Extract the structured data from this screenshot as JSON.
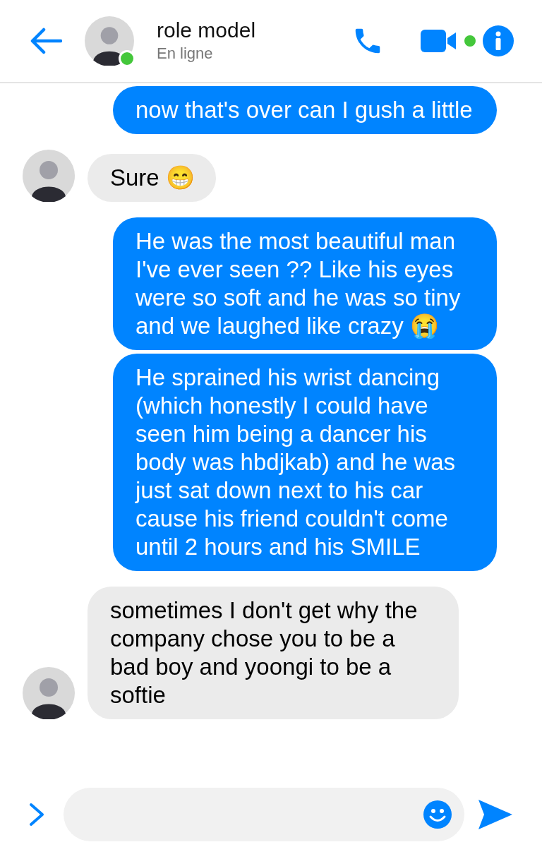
{
  "header": {
    "name": "role model",
    "status": "En ligne",
    "online": true
  },
  "messages": [
    {
      "kind": "sent",
      "text": "now that's over can I gush a little"
    },
    {
      "kind": "received",
      "text": "Sure 😁",
      "avatar": true
    },
    {
      "kind": "sent",
      "text": "He was the most beautiful man I've ever seen ?? Like his eyes were so soft and he was so tiny and we laughed like crazy 😭"
    },
    {
      "kind": "sent",
      "text": "He sprained his wrist dancing (which honestly I could have seen him being a dancer his body was hbdjkab) and he was just sat down next to his car cause his friend couldn't come until 2 hours and his SMILE"
    },
    {
      "kind": "received",
      "text": "sometimes I don't get why the company chose you to be a bad boy and yoongi to be a softie",
      "avatar": true
    }
  ]
}
